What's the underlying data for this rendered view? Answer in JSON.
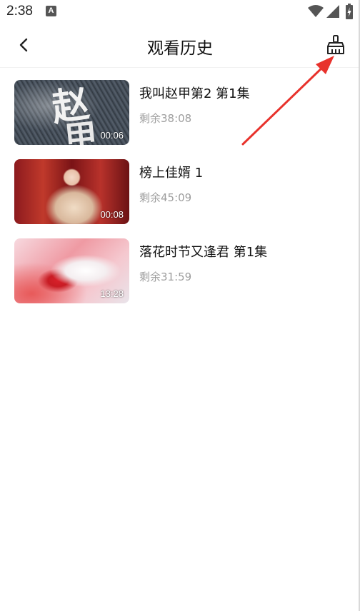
{
  "status_bar": {
    "time": "2:38",
    "notification_glyph": "A",
    "icons": [
      "wifi-icon",
      "signal-icon",
      "battery-icon"
    ]
  },
  "header": {
    "title": "观看历史",
    "back_icon": "chevron-left-icon",
    "clean_icon": "broom-icon"
  },
  "history": [
    {
      "title": "我叫赵甲第2 第1集",
      "remaining": "剩余38:08",
      "duration": "00:06"
    },
    {
      "title": "榜上佳婿 1",
      "remaining": "剩余45:09",
      "duration": "00:08"
    },
    {
      "title": "落花时节又逢君 第1集",
      "remaining": "剩余31:59",
      "duration": "13:28"
    }
  ],
  "colors": {
    "annotation_arrow": "#e8322c",
    "secondary_text": "#9e9e9e",
    "title_text": "#111111"
  }
}
